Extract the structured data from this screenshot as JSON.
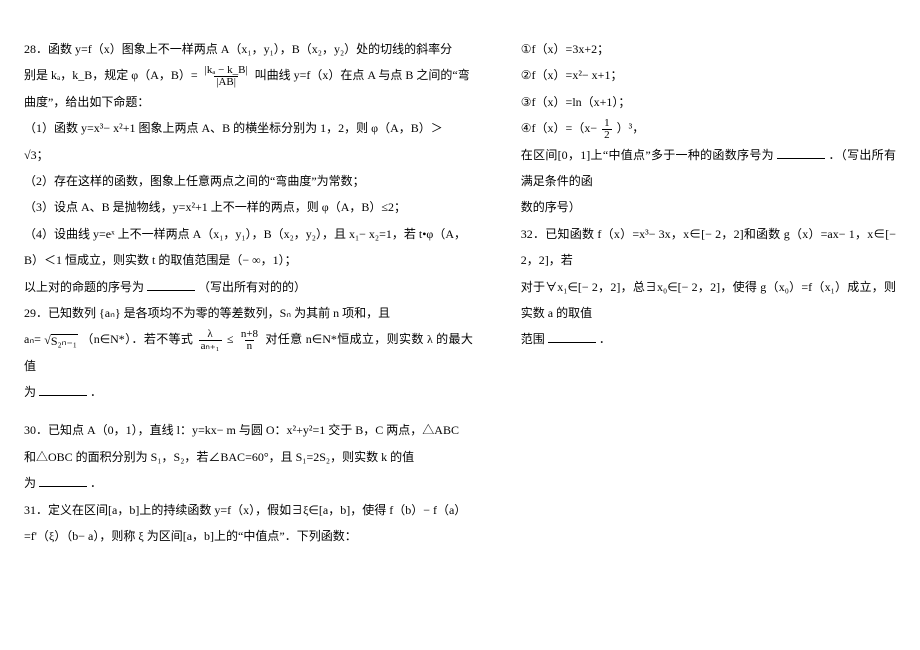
{
  "left": {
    "p28_1": "28．函数 y=f（x）图象上不一样两点 A（x₁，y₁），B（x₂，y₂）处的切线的斜率分",
    "p28_2a": "别是 kₐ，k_B，规定 φ（A，B）=",
    "p28_2_num": "|kₐ − k_B|",
    "p28_2_den": "|AB|",
    "p28_2b": "叫曲线 y=f（x）在点 A 与点 B 之间的“弯",
    "p28_3": "曲度”，给出如下命题：",
    "p28_4": "（1）函数 y=x³− x²+1 图象上两点 A、B 的横坐标分别为 1，2，则 φ（A，B）＞",
    "p28_5": "√3；",
    "p28_6": "（2）存在这样的函数，图象上任意两点之间的“弯曲度”为常数；",
    "p28_7": "（3）设点 A、B 是抛物线，y=x²+1 上不一样的两点，则 φ（A，B）≤2；",
    "p28_8": "（4）设曲线 y=eˣ 上不一样两点 A（x₁，y₁），B（x₂，y₂），且 x₁− x₂=1，若 t•φ（A，",
    "p28_9": "B）＜1 恒成立，则实数 t 的取值范围是（− ∞，1）；",
    "p28_10a": "以上对的命题的序号为",
    "p28_10b": "（写出所有对的的）",
    "p29_1a": "29．已知数列 {aₙ} 是各项均不为零的等差数列，Sₙ 为其前 n 项和，且",
    "p29_2a": "aₙ=",
    "p29_2sqrt": "S₂ₙ₋₁",
    "p29_2b": "（n∈N*）．若不等式",
    "p29_2_num1": "λ",
    "p29_2_den1": "aₙ₊₁",
    "p29_2c": "≤",
    "p29_2_num2": "n+8",
    "p29_2_den2": "n",
    "p29_2d": "对任意 n∈N*恒成立，则实数 λ 的最大值",
    "p29_3a": "为",
    "p29_3b": "．",
    "p30_1": "30．已知点 A（0，1），直线 l：y=kx− m 与圆 O：x²+y²=1 交于 B，C 两点，△ABC",
    "p30_2": "和△OBC 的面积分别为 S₁，S₂，若∠BAC=60°，且 S₁=2S₂，则实数 k 的值",
    "p30_3a": "为",
    "p30_3b": "．",
    "p31_1": "31．定义在区间[a，b]上的持续函数 y=f（x），假如∃ξ∈[a，b]，使得 f（b）− f（a）",
    "p31_2": "=f'（ξ）（b− a），则称 ξ 为区间[a，b]上的“中值点”．下列函数："
  },
  "right": {
    "f1": "①f（x）=3x+2；",
    "f2": "②f（x）=x²− x+1；",
    "f3": "③f（x）=ln（x+1）；",
    "f4a": "④f（x）=（x−",
    "f4_num": "1",
    "f4_den": "2",
    "f4b": "）³，",
    "p31b_1a": "在区间[0，1]上“中值点”多于一种的函数序号为",
    "p31b_1b": "．（写出所有满足条件的函",
    "p31b_2": "数的序号）",
    "p32_1": "32．已知函数 f（x）=x³− 3x，x∈[− 2，2]和函数 g（x）=ax− 1，x∈[− 2，2]，若",
    "p32_2": "对于∀x₁∈[− 2，2]，总∃x₀∈[− 2，2]，使得 g（x₀）=f（x₁）成立，则实数 a 的取值",
    "p32_3a": "范围",
    "p32_3b": "．"
  }
}
